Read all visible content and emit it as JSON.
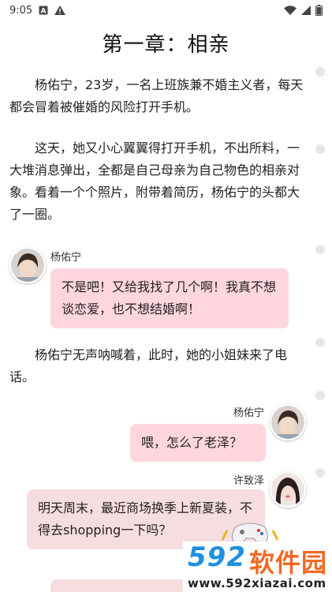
{
  "status_bar": {
    "time": "9:05",
    "left_icons": [
      "a-box-icon",
      "alert-triangle-icon"
    ],
    "right_icons": [
      "wifi-icon",
      "signal-icon",
      "battery-icon"
    ]
  },
  "chapter": {
    "title": "第一章：相亲"
  },
  "paragraphs": [
    "杨佑宁，23岁，一名上班族兼不婚主义者，每天都会冒着被催婚的风险打开手机。",
    "这天，她又小心翼翼得打开手机，不出所料，一大堆消息弹出，全都是自己母亲为自己物色的相亲对象。看着一个个照片，附带着简历，杨佑宁的头都大了一圈。",
    "杨佑宁无声呐喊着，此时，她的小姐妹来了电话。"
  ],
  "messages": [
    {
      "speaker": "杨佑宁",
      "text": "不是吧！又给我找了几个啊！我真不想谈恋爱，也不想结婚啊！",
      "side": "left"
    },
    {
      "speaker": "杨佑宁",
      "text": "喂，怎么了老泽？",
      "side": "right"
    },
    {
      "speaker": "许致泽",
      "text": "明天周末，最近商场换季上新夏装，不得去shopping一下吗？",
      "side": "left"
    }
  ],
  "watermark": {
    "logo": "592",
    "name": "软件园",
    "url": "www.592xiazai.com"
  },
  "colors": {
    "bubble_pink": "#ffd5de",
    "bubble_pale": "#f6dde0",
    "watermark_blue": "#1f8fe0",
    "watermark_orange": "#f06a25"
  }
}
